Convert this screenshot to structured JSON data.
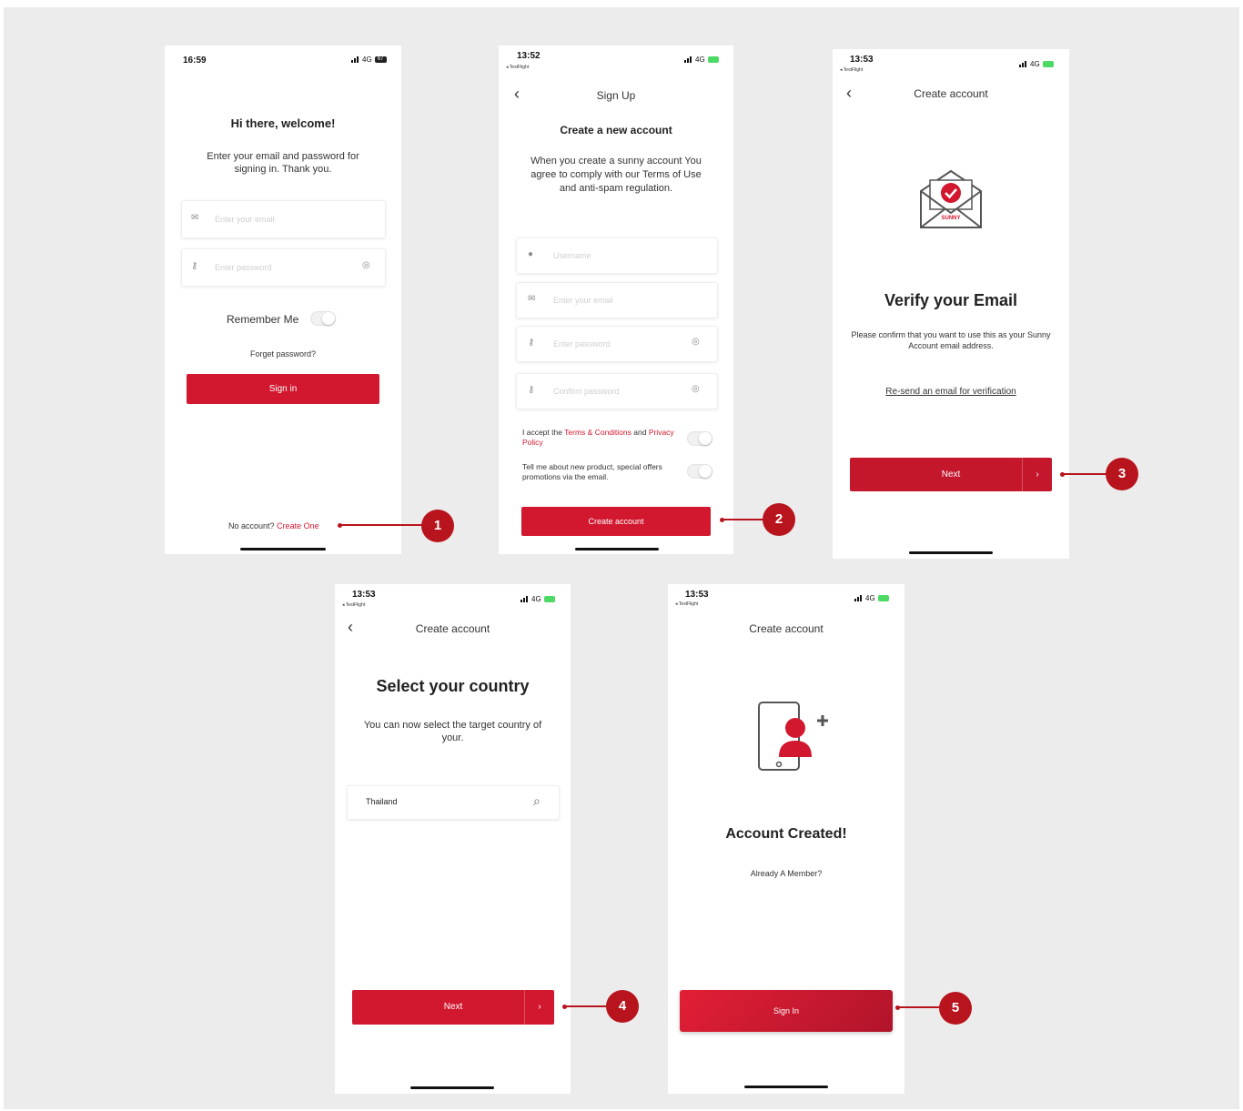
{
  "screens": {
    "s1": {
      "time": "16:59",
      "network": "4G",
      "battery": "67",
      "title": "Hi there, welcome!",
      "subtitle": "Enter your email and password for signing in. Thank you.",
      "email_placeholder": "Enter your email",
      "password_placeholder": "Enter password",
      "remember_label": "Remember Me",
      "forgot_label": "Forget password?",
      "signin_label": "Sign in",
      "no_account_label": "No account?",
      "create_link": "Create One"
    },
    "s2": {
      "time": "13:52",
      "back_app": "◂ TestFlight",
      "network": "4G",
      "nav_title": "Sign Up",
      "title": "Create a new account",
      "subtitle": "When you create a sunny account You agree to comply with our Terms of Use and anti-spam regulation.",
      "username_placeholder": "Username",
      "email_placeholder": "Enter your email",
      "password_placeholder": "Enter password",
      "confirm_placeholder": "Confirm password",
      "accept_prefix": "I accept the",
      "terms_link": "Terms & Conditions",
      "accept_and": "and",
      "privacy_link": "Privacy Policy",
      "promo_label": "Tell me about new product, special offers promotions via the email.",
      "create_button": "Create account"
    },
    "s3": {
      "time": "13:53",
      "back_app": "◂ TestFlight",
      "network": "4G",
      "nav_title": "Create account",
      "envelope_brand": "SUNNY",
      "title": "Verify your Email",
      "subtitle": "Please confirm that you want to use this as your Sunny Account email address.",
      "resend_link": "Re-send an email for verification",
      "next_label": "Next"
    },
    "s4": {
      "time": "13:53",
      "back_app": "◂ TestFlight",
      "network": "4G",
      "nav_title": "Create account",
      "title": "Select your country",
      "subtitle": "You can now select the target country of your.",
      "country_value": "Thailand",
      "next_label": "Next"
    },
    "s5": {
      "time": "13:53",
      "back_app": "◂ TestFlight",
      "network": "4G",
      "nav_title": "Create account",
      "title": "Account Created!",
      "member_label": "Already A Member?",
      "signin_label": "Sign In"
    }
  },
  "callouts": [
    "1",
    "2",
    "3",
    "4",
    "5"
  ],
  "colors": {
    "accent": "#d1182f",
    "callout": "#b8141d",
    "background": "#ececec"
  }
}
